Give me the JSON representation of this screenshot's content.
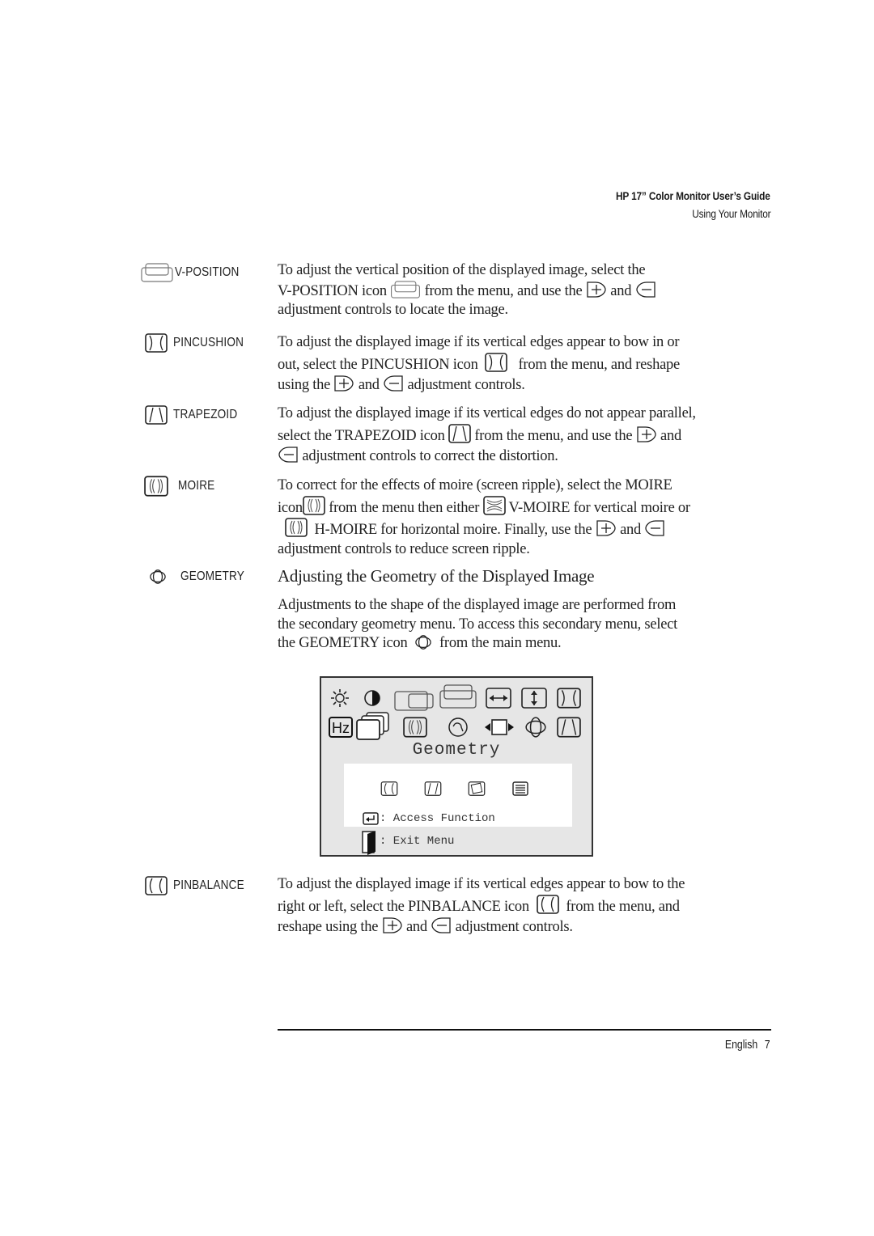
{
  "header": {
    "title": "HP 17” Color Monitor User’s Guide",
    "subtitle": "Using Your Monitor"
  },
  "sections": {
    "vposition": {
      "label": "V-POSITION",
      "icon": "v-position-icon",
      "text": [
        "To adjust the vertical position of the displayed image, select the",
        "V-POSITION icon",
        "from the menu, and use the",
        "and",
        "adjustment controls to locate the image."
      ]
    },
    "pincushion": {
      "label": "PINCUSHION",
      "icon": "pincushion-icon",
      "text": [
        "To adjust the displayed image if its vertical edges appear to bow in or",
        "out, select the PINCUSHION icon",
        "from the menu, and reshape",
        "using the",
        "and",
        "adjustment controls."
      ]
    },
    "trapezoid": {
      "label": "TRAPEZOID",
      "icon": "trapezoid-icon",
      "text": [
        "To adjust the displayed image if its vertical edges do not appear parallel,",
        "select the TRAPEZOID icon",
        "from the menu, and use the",
        "and",
        "adjustment controls to correct the distortion."
      ]
    },
    "moire": {
      "label": "MOIRE",
      "icon": "moire-icon",
      "text": [
        "To correct for the effects of moire (screen ripple), select the MOIRE",
        "icon",
        "from the menu then either",
        "V-MOIRE for vertical moire or",
        "H-MOIRE for horizontal moire. Finally, use the",
        "and",
        "adjustment controls to reduce screen ripple."
      ]
    },
    "geometry": {
      "label": "GEOMETRY",
      "icon": "geometry-icon",
      "heading": "Adjusting the Geometry of the Displayed Image",
      "text": [
        "Adjustments to the shape of the displayed image are performed from",
        "the secondary geometry menu. To access this secondary menu, select",
        "the GEOMETRY icon",
        "from the main menu."
      ]
    },
    "pinbalance": {
      "label": "PINBALANCE",
      "icon": "pinbalance-icon",
      "text": [
        "To adjust the displayed image if its vertical edges appear to bow to the",
        "right or left, select the PINBALANCE icon",
        "from the menu, and",
        "reshape using the",
        "and",
        "adjustment controls."
      ]
    }
  },
  "osd_menu": {
    "title": "Geometry",
    "main_icons_row1": [
      "brightness-icon",
      "contrast-icon",
      "h-position-icon",
      "v-position-icon",
      "h-size-icon",
      "v-size-icon",
      "pincushion-icon"
    ],
    "main_icons_row2": [
      "hz-icon",
      "recall-icon",
      "moire-icon",
      "degauss-icon",
      "zoom-icon",
      "geometry-icon",
      "trapezoid-icon"
    ],
    "sub_icons": [
      "pinbalance-icon",
      "parallelogram-icon",
      "rotation-icon",
      "info-icon"
    ],
    "access_label": ": Access Function",
    "exit_label": ": Exit Menu"
  },
  "footer": {
    "language": "English",
    "page_number": "7"
  }
}
